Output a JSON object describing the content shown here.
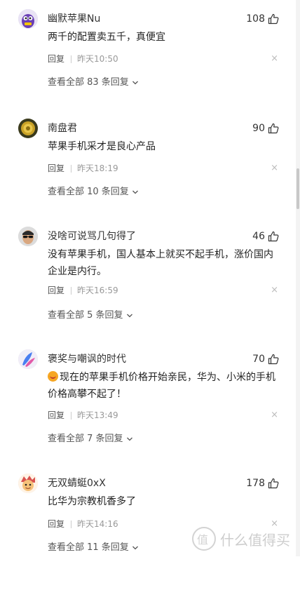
{
  "comments": [
    {
      "username": "幽默苹果Nu",
      "likes": "108",
      "text": "两千的配置卖五千，真便宜",
      "reply_label": "回复",
      "time": "昨天10:50",
      "close": "×",
      "view_all": "查看全部 83 条回复",
      "avatar": "purple-cartoon-avatar",
      "has_emoji": false
    },
    {
      "username": "南盘君",
      "likes": "90",
      "text": "苹果手机采才是良心产品",
      "reply_label": "回复",
      "time": "昨天18:19",
      "close": "×",
      "view_all": "查看全部 10 条回复",
      "avatar": "gold-emblem-avatar",
      "has_emoji": false
    },
    {
      "username": "没啥可说骂几句得了",
      "likes": "46",
      "text": "没有苹果手机，国人基本上就买不起手机，涨价国内企业是内行。",
      "reply_label": "回复",
      "time": "昨天16:59",
      "close": "×",
      "view_all": "查看全部 5 条回复",
      "avatar": "sunglasses-man-avatar",
      "has_emoji": false
    },
    {
      "username": "褒奖与嘲讽的时代",
      "likes": "70",
      "text": "现在的苹果手机价格开始亲民，华为、小米的手机价格高攀不起了！",
      "reply_label": "回复",
      "time": "昨天13:49",
      "close": "×",
      "view_all": "查看全部 7 条回复",
      "avatar": "blue-pink-feather-avatar",
      "has_emoji": true
    },
    {
      "username": "无双蜻蜓0xX",
      "likes": "178",
      "text": "比华为宗教机香多了",
      "reply_label": "回复",
      "time": "昨天14:16",
      "close": "×",
      "view_all": "查看全部 11 条回复",
      "avatar": "cartoon-character-avatar",
      "has_emoji": false
    }
  ],
  "watermark": {
    "text": "什么值得买"
  },
  "colors": {
    "text_primary": "#222222",
    "text_secondary": "#555555",
    "text_muted": "#999999"
  }
}
